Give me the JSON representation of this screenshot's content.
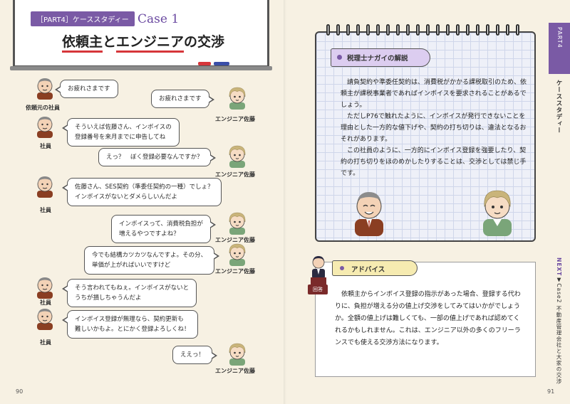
{
  "left_page": {
    "header": {
      "tag": "［PART4］ケーススタディー",
      "case_label": "Case 1",
      "title_part1": "依頼主",
      "title_part2": "と",
      "title_part3": "エンジニア",
      "title_part4": "の交渉"
    },
    "dialogue": [
      {
        "speaker": "依頼元の社員",
        "side": "left",
        "lines": [
          "お疲れさまです"
        ]
      },
      {
        "speaker": "エンジニア佐藤",
        "side": "right",
        "lines": [
          "お疲れさまです"
        ]
      },
      {
        "speaker": "社員",
        "side": "left",
        "lines": [
          "そういえば佐藤さん、インボイスの",
          "登録番号を来月までに申告してね"
        ]
      },
      {
        "speaker": "エンジニア佐藤",
        "side": "right",
        "lines": [
          "えっ？　ぼく登録必要なんですか？"
        ]
      },
      {
        "speaker": "社員",
        "side": "left",
        "lines": [
          "佐藤さん、SES契約（準委任契約の一種）でしょ？",
          "インボイスがないとダメらしいんだよ"
        ]
      },
      {
        "speaker": "エンジニア佐藤",
        "side": "right",
        "lines": [
          "インボイスって、消費税負担が",
          "増えるやつですよね？"
        ]
      },
      {
        "speaker": "エンジニア佐藤",
        "side": "right",
        "lines": [
          "今でも結構カツカツなんですよ。その分、",
          "単価が上がればいいですけど"
        ]
      },
      {
        "speaker": "社員",
        "side": "left",
        "lines": [
          "そう言われてもねぇ。インボイスがないと",
          "うちが損しちゃうんだよ"
        ]
      },
      {
        "speaker": "社員",
        "side": "left",
        "lines": [
          "インボイス登録が無理なら、契約更新も",
          "難しいかもよ。とにかく登録よろしくね！"
        ]
      },
      {
        "speaker": "エンジニア佐藤",
        "side": "right",
        "lines": [
          "ええっ！"
        ]
      }
    ],
    "page_number": "90"
  },
  "right_page": {
    "side_tab": "PART4",
    "side_label": "ケーススタディー",
    "explanation_title": "税理士ナガイの解説",
    "paragraphs": [
      "請負契約や準委任契約は、消費税がかかる課税取引のため、依頼主が課税事業者であればインボイスを要求されることがあるでしょう。",
      "ただしP76で触れたように、インボイスが発行できないことを理由とした一方的な値下げや、契約の打ち切りは、違法となるおそれがあります。",
      "この社員のように、一方的にインボイス登録を強要したり、契約の打ち切りをほのめかしたりすることは、交渉としては禁じ手です。"
    ],
    "advice_title": "アドバイス",
    "answer_badge": "回答",
    "advice_text": "依頼主からインボイス登録の指示があった場合、登録する代わりに、負担が増える分の値上げ交渉をしてみてはいかがでしょうか。全額の値上げは難しくても、一部の値上げであれば認めてくれるかもしれません。これは、エンジニア以外の多くのフリーランスでも使える交渉方法になります。",
    "next_prefix": "NEXT",
    "next_label": "Case2 不動産管理会社と大家の交渉",
    "page_number": "91"
  },
  "colors": {
    "accent_purple": "#7a5aa5",
    "underline_red": "#d6363a",
    "advice_yellow": "#f6ebb1",
    "explain_lavender": "#dccdf0"
  },
  "icons": {
    "employee": "older-man-icon",
    "engineer": "young-man-icon",
    "advisor": "tax-advisor-icon"
  }
}
